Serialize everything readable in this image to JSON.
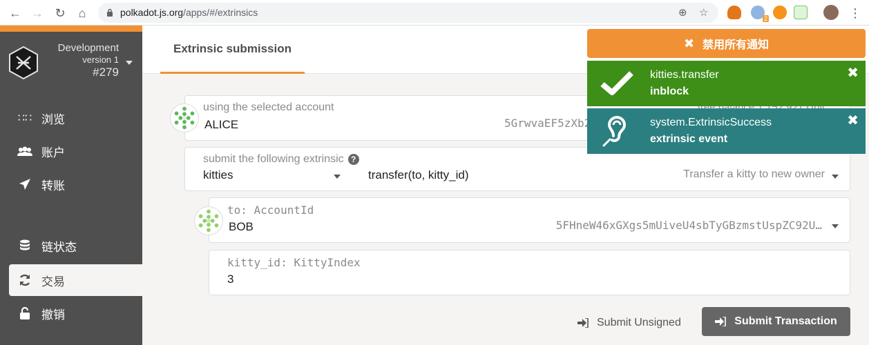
{
  "browser": {
    "url_host": "polkadot.js.org",
    "url_path": "/apps/#/extrinsics",
    "ext_badge": "2"
  },
  "sidebar": {
    "chain_name": "Development",
    "chain_version": "version 1",
    "chain_block": "#279",
    "items": [
      {
        "label": "浏览",
        "icon": "grid-icon"
      },
      {
        "label": "账户",
        "icon": "users-icon"
      },
      {
        "label": "转账",
        "icon": "send-icon"
      },
      {
        "label": "链状态",
        "icon": "database-icon"
      },
      {
        "label": "交易",
        "icon": "sync-icon"
      },
      {
        "label": "撤销",
        "icon": "unlock-icon"
      }
    ]
  },
  "main": {
    "tab_label": "Extrinsic submission",
    "account": {
      "label": "using the selected account",
      "balance_label": "free balance 1.152 921 Unit",
      "value": "ALICE",
      "address": "5GrwvaEF5zXb26Fz9rcQpDWS57CtERHpNehXCPcNoHGKutQY"
    },
    "extrinsic": {
      "label": "submit the following extrinsic",
      "module": "kitties",
      "method": "transfer(to, kitty_id)",
      "description": "Transfer a kitty to new owner"
    },
    "param_to": {
      "label": "to: AccountId",
      "value": "BOB",
      "address": "5FHneW46xGXgs5mUiveU4sbTyGBzmstUspZC92U…"
    },
    "param_kitty": {
      "label": "kitty_id: KittyIndex",
      "value": "3"
    },
    "btn_unsigned": "Submit Unsigned",
    "btn_submit": "Submit Transaction"
  },
  "notifications": {
    "dismiss_all": "禁用所有通知",
    "items": [
      {
        "title": "kitties.transfer",
        "status": "inblock",
        "color": "#3d8f17"
      },
      {
        "title": "system.ExtrinsicSuccess",
        "status": "extrinsic event",
        "color": "#2b7f80"
      }
    ]
  },
  "colors": {
    "accent": "#f19135",
    "sidebar_bg": "#4f4f4f",
    "button_bg": "#666666"
  }
}
